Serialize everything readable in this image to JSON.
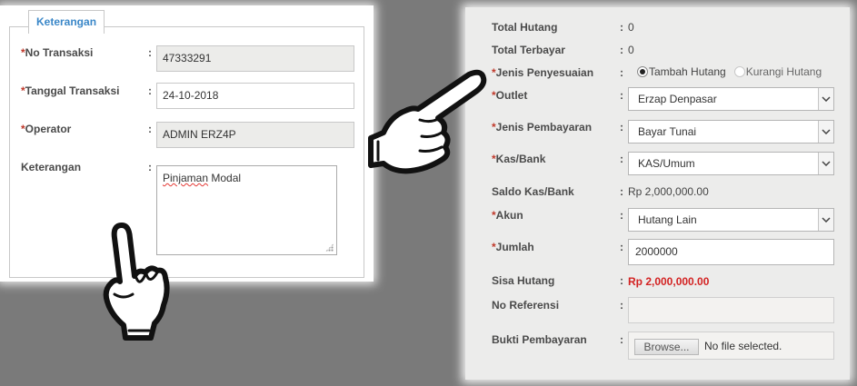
{
  "left_form": {
    "legend": "Keterangan",
    "no_transaksi": {
      "required_mark": "*",
      "label": "No Transaksi",
      "value": "47333291"
    },
    "tanggal_transaksi": {
      "required_mark": "*",
      "label": "Tanggal Transaksi",
      "value": "24-10-2018"
    },
    "operator": {
      "required_mark": "*",
      "label": "Operator",
      "value": "ADMIN ERZ4P"
    },
    "keterangan": {
      "label": "Keterangan",
      "value_word1": "Pinjaman",
      "value_word2": " Modal"
    },
    "colon": ":"
  },
  "right_form": {
    "colon": ":",
    "total_hutang": {
      "label": "Total Hutang",
      "value": "0"
    },
    "total_terbayar": {
      "label": "Total Terbayar",
      "value": "0"
    },
    "jenis_penyesuaian": {
      "required_mark": "*",
      "label": "Jenis Penyesuaian",
      "options": [
        "Tambah Hutang",
        "Kurangi Hutang"
      ],
      "selected": "Tambah Hutang"
    },
    "outlet": {
      "required_mark": "*",
      "label": "Outlet",
      "value": "Erzap Denpasar"
    },
    "jenis_pembayaran": {
      "required_mark": "*",
      "label": "Jenis Pembayaran",
      "value": "Bayar Tunai"
    },
    "kas_bank": {
      "required_mark": "*",
      "label": "Kas/Bank",
      "value": "KAS/Umum"
    },
    "saldo_kas_bank": {
      "label": "Saldo Kas/Bank",
      "value": "Rp 2,000,000.00"
    },
    "akun": {
      "required_mark": "*",
      "label": "Akun",
      "value": "Hutang Lain"
    },
    "jumlah": {
      "required_mark": "*",
      "label": "Jumlah",
      "value": "2000000"
    },
    "sisa_hutang": {
      "label": "Sisa Hutang",
      "value": "Rp 2,000,000.00",
      "color": "#d32222"
    },
    "no_referensi": {
      "label": "No Referensi",
      "value": ""
    },
    "bukti_pembayaran": {
      "label": "Bukti Pembayaran",
      "browse_label": "Browse...",
      "file_status": "No file selected."
    }
  },
  "icons": [
    "pointing-up-hand-icon",
    "pointing-right-hand-icon",
    "chevron-down-icon",
    "resize-grip-icon"
  ]
}
